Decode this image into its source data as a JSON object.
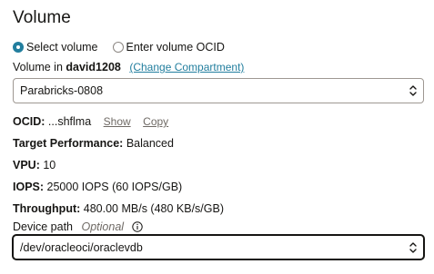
{
  "section": {
    "title": "Volume"
  },
  "selection_mode": {
    "options": [
      {
        "label": "Select volume",
        "selected": true
      },
      {
        "label": "Enter volume OCID",
        "selected": false
      }
    ]
  },
  "compartment": {
    "prefix": "Volume in",
    "name": "david1208",
    "change_link": "(Change Compartment)"
  },
  "volume_select": {
    "value": "Parabricks-0808"
  },
  "ocid": {
    "label": "OCID:",
    "value": "...shflma",
    "show_link": "Show",
    "copy_link": "Copy"
  },
  "details": {
    "target_performance": {
      "label": "Target Performance:",
      "value": "Balanced"
    },
    "vpu": {
      "label": "VPU:",
      "value": "10"
    },
    "iops": {
      "label": "IOPS:",
      "value": "25000 IOPS (60 IOPS/GB)"
    },
    "throughput": {
      "label": "Throughput:",
      "value": "480.00 MB/s (480 KB/s/GB)"
    }
  },
  "device_path": {
    "label": "Device path",
    "optional": "Optional",
    "value": "/dev/oracleoci/oraclevdb"
  },
  "icons": {
    "select_chevron": "chevron-up-down-icon",
    "info": "info-icon"
  },
  "colors": {
    "accent": "#227e9e",
    "text": "#161513",
    "muted": "#6f6a65"
  }
}
